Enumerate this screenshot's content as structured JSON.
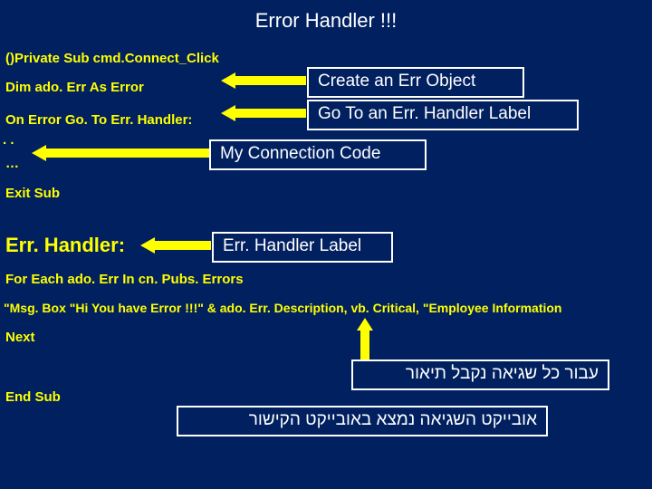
{
  "title": "Error Handler !!!",
  "code": {
    "line1": "()Private Sub cmd.Connect_Click",
    "line2": "Dim ado. Err As Error",
    "line3": "On Error Go. To Err. Handler:",
    "dots1": ". .",
    "dots2": "…",
    "exit": "Exit Sub",
    "label": "Err. Handler:",
    "foreach": "For Each ado. Err In cn. Pubs. Errors",
    "msgbox": "\"Msg. Box \"Hi You have Error !!!\" & ado. Err. Description, vb. Critical, \"Employee Information",
    "next": "Next",
    "endsub": "End Sub"
  },
  "callouts": {
    "create": "Create an Err Object",
    "goto": "Go To an Err. Handler Label",
    "myconn": "My Connection  Code",
    "errlabel": "Err. Handler Label",
    "desc_he": "עבור כל שגיאה נקבל תיאור",
    "obj_he": "אובייקט השגיאה נמצא באובייקט הקישור"
  }
}
